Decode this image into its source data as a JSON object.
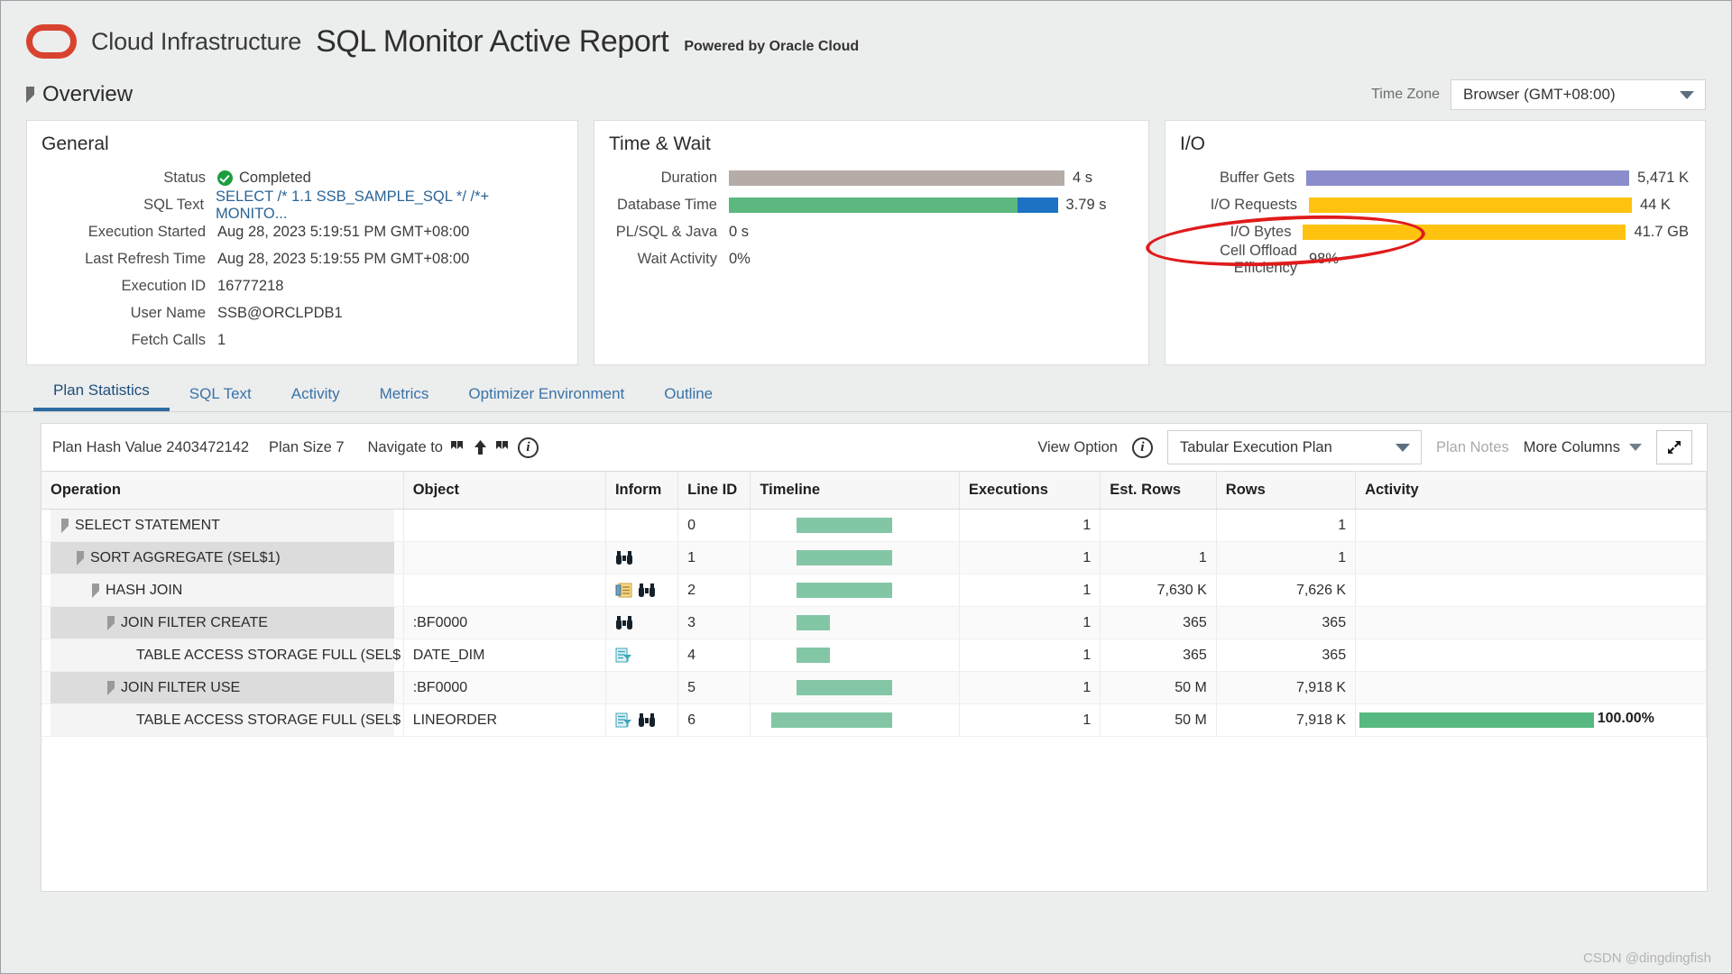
{
  "header": {
    "brand_cloud": "Cloud Infrastructure",
    "title": "SQL Monitor Active Report",
    "powered_by": "Powered by Oracle Cloud",
    "logo_color": "#d7432f"
  },
  "overview": {
    "label": "Overview",
    "timezone_label": "Time Zone",
    "timezone_value": "Browser (GMT+08:00)"
  },
  "general": {
    "title": "General",
    "rows": [
      {
        "label": "Status",
        "value": "Completed",
        "icon": "check-circle-icon"
      },
      {
        "label": "SQL Text",
        "value": "SELECT /* 1.1 SSB_SAMPLE_SQL */ /*+ MONITO...",
        "link": true
      },
      {
        "label": "Execution Started",
        "value": "Aug 28, 2023 5:19:51 PM GMT+08:00"
      },
      {
        "label": "Last Refresh Time",
        "value": "Aug 28, 2023 5:19:55 PM GMT+08:00"
      },
      {
        "label": "Execution ID",
        "value": "16777218"
      },
      {
        "label": "User Name",
        "value": "SSB@ORCLPDB1"
      },
      {
        "label": "Fetch Calls",
        "value": "1"
      }
    ]
  },
  "time_wait": {
    "title": "Time & Wait",
    "rows": [
      {
        "label": "Duration",
        "value": "4 s",
        "bar": true,
        "segments": [
          {
            "pct": 100,
            "color": "#b5aca8"
          }
        ]
      },
      {
        "label": "Database Time",
        "value": "3.79 s",
        "bar": true,
        "segments": [
          {
            "pct": 86,
            "color": "#5cb87e"
          },
          {
            "pct": 12,
            "color": "#1d72c4"
          }
        ]
      },
      {
        "label": "PL/SQL & Java",
        "value": "0 s",
        "bar": false
      },
      {
        "label": "Wait Activity",
        "value": "0%",
        "bar": false
      }
    ]
  },
  "io": {
    "title": "I/O",
    "rows": [
      {
        "label": "Buffer Gets",
        "value": "5,471 K",
        "bar": true,
        "segments": [
          {
            "pct": 100,
            "color": "#8b8ccb"
          }
        ]
      },
      {
        "label": "I/O Requests",
        "value": "44 K",
        "bar": true,
        "segments": [
          {
            "pct": 100,
            "color": "#ffc20e"
          }
        ]
      },
      {
        "label": "I/O Bytes",
        "value": "41.7 GB",
        "bar": true,
        "segments": [
          {
            "pct": 100,
            "color": "#ffc20e"
          }
        ]
      },
      {
        "label": "Cell Offload Efficiency",
        "value": "98%",
        "bar": false
      }
    ],
    "annotation_color": "#e01b1b"
  },
  "tabs": [
    {
      "label": "Plan Statistics",
      "active": true
    },
    {
      "label": "SQL Text",
      "active": false
    },
    {
      "label": "Activity",
      "active": false
    },
    {
      "label": "Metrics",
      "active": false
    },
    {
      "label": "Optimizer Environment",
      "active": false
    },
    {
      "label": "Outline",
      "active": false
    }
  ],
  "plan_toolbar": {
    "plan_hash_value": "Plan Hash Value 2403472142",
    "plan_size": "Plan Size 7",
    "navigate_to": "Navigate to",
    "view_option_label": "View Option",
    "view_option_value": "Tabular Execution Plan",
    "plan_notes": "Plan Notes",
    "more_columns": "More Columns"
  },
  "plan_table": {
    "columns": [
      "Operation",
      "Object",
      "Inform",
      "Line ID",
      "Timeline",
      "Executions",
      "Est. Rows",
      "Rows",
      "Activity"
    ],
    "rows": [
      {
        "operation": "SELECT STATEMENT",
        "indent": 0,
        "expander": true,
        "object": "",
        "icons": [],
        "line_id": "0",
        "timeline_start": 22,
        "timeline_width": 46,
        "executions": "1",
        "est_rows": "",
        "rows": "1",
        "activity_pct": null,
        "activity_label": ""
      },
      {
        "operation": "SORT AGGREGATE (SEL$1)",
        "indent": 1,
        "expander": true,
        "object": "",
        "icons": [
          "binoculars-icon"
        ],
        "line_id": "1",
        "timeline_start": 22,
        "timeline_width": 46,
        "executions": "1",
        "est_rows": "1",
        "rows": "1",
        "activity_pct": null,
        "activity_label": ""
      },
      {
        "operation": "HASH JOIN",
        "indent": 2,
        "expander": true,
        "object": "",
        "icons": [
          "note-icon",
          "binoculars-icon"
        ],
        "line_id": "2",
        "timeline_start": 22,
        "timeline_width": 46,
        "executions": "1",
        "est_rows": "7,630 K",
        "rows": "7,626 K",
        "activity_pct": null,
        "activity_label": ""
      },
      {
        "operation": "JOIN FILTER CREATE",
        "indent": 3,
        "expander": true,
        "object": ":BF0000",
        "icons": [
          "binoculars-icon"
        ],
        "line_id": "3",
        "timeline_start": 22,
        "timeline_width": 16,
        "executions": "1",
        "est_rows": "365",
        "rows": "365",
        "activity_pct": null,
        "activity_label": ""
      },
      {
        "operation": "TABLE ACCESS STORAGE FULL (SEL$",
        "indent": 4,
        "expander": false,
        "object": "DATE_DIM",
        "icons": [
          "filter-table-icon"
        ],
        "line_id": "4",
        "timeline_start": 22,
        "timeline_width": 16,
        "executions": "1",
        "est_rows": "365",
        "rows": "365",
        "activity_pct": null,
        "activity_label": ""
      },
      {
        "operation": "JOIN FILTER USE",
        "indent": 3,
        "expander": true,
        "object": ":BF0000",
        "icons": [],
        "line_id": "5",
        "timeline_start": 22,
        "timeline_width": 46,
        "executions": "1",
        "est_rows": "50 M",
        "rows": "7,918 K",
        "activity_pct": null,
        "activity_label": ""
      },
      {
        "operation": "TABLE ACCESS STORAGE FULL (SEL$",
        "indent": 4,
        "expander": false,
        "object": "LINEORDER",
        "icons": [
          "filter-table-icon",
          "binoculars-icon"
        ],
        "line_id": "6",
        "timeline_start": 10,
        "timeline_width": 58,
        "executions": "1",
        "est_rows": "50 M",
        "rows": "7,918 K",
        "activity_pct": 67,
        "activity_label": "100.00%"
      }
    ]
  },
  "watermark": "CSDN @dingdingfish"
}
